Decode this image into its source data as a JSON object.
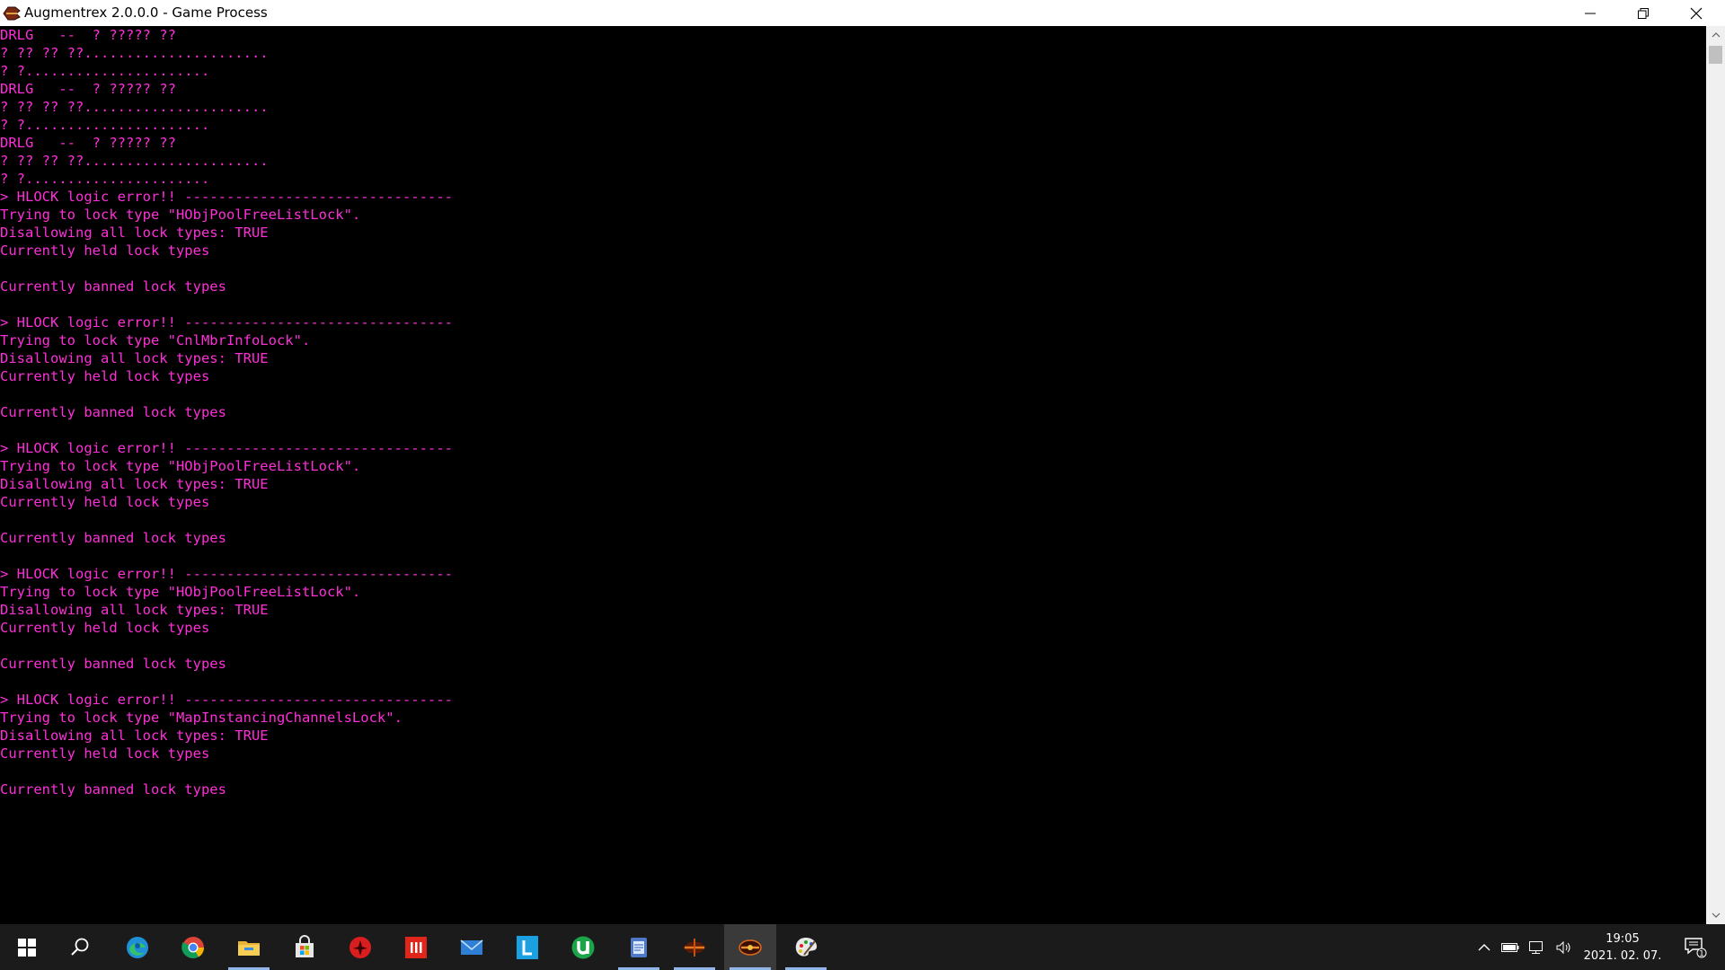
{
  "window": {
    "title": "Augmentrex 2.0.0.0 - Game Process"
  },
  "console": {
    "text_color": "#ff2fd8",
    "lines": [
      "DRLG   --  ? ????? ??",
      "? ?? ?? ??......................",
      "? ?......................",
      "DRLG   --  ? ????? ??",
      "? ?? ?? ??......................",
      "? ?......................",
      "DRLG   --  ? ????? ??",
      "? ?? ?? ??......................",
      "? ?......................",
      "> HLOCK logic error!! --------------------------------",
      "Trying to lock type \"HObjPoolFreeListLock\".",
      "Disallowing all lock types: TRUE",
      "Currently held lock types",
      "",
      "Currently banned lock types",
      "",
      "> HLOCK logic error!! --------------------------------",
      "Trying to lock type \"CnlMbrInfoLock\".",
      "Disallowing all lock types: TRUE",
      "Currently held lock types",
      "",
      "Currently banned lock types",
      "",
      "> HLOCK logic error!! --------------------------------",
      "Trying to lock type \"HObjPoolFreeListLock\".",
      "Disallowing all lock types: TRUE",
      "Currently held lock types",
      "",
      "Currently banned lock types",
      "",
      "> HLOCK logic error!! --------------------------------",
      "Trying to lock type \"HObjPoolFreeListLock\".",
      "Disallowing all lock types: TRUE",
      "Currently held lock types",
      "",
      "Currently banned lock types",
      "",
      "> HLOCK logic error!! --------------------------------",
      "Trying to lock type \"MapInstancingChannelsLock\".",
      "Disallowing all lock types: TRUE",
      "Currently held lock types",
      "",
      "Currently banned lock types"
    ]
  },
  "taskbar": {
    "apps": [
      {
        "icon": "windows-start-icon"
      },
      {
        "icon": "search-icon"
      },
      {
        "icon": "edge-icon"
      },
      {
        "icon": "chrome-icon"
      },
      {
        "icon": "file-explorer-icon"
      },
      {
        "icon": "store-icon"
      },
      {
        "icon": "red-app-icon"
      },
      {
        "icon": "red-bars-app-icon"
      },
      {
        "icon": "mail-icon"
      },
      {
        "icon": "l-app-icon"
      },
      {
        "icon": "utorrent-icon"
      },
      {
        "icon": "notepad-app-icon"
      },
      {
        "icon": "game-launcher-icon"
      },
      {
        "icon": "augmentrex-icon"
      },
      {
        "icon": "paint-icon"
      }
    ],
    "clock": {
      "time": "19:05",
      "date": "2021. 02. 07."
    },
    "notification_count": "1"
  }
}
